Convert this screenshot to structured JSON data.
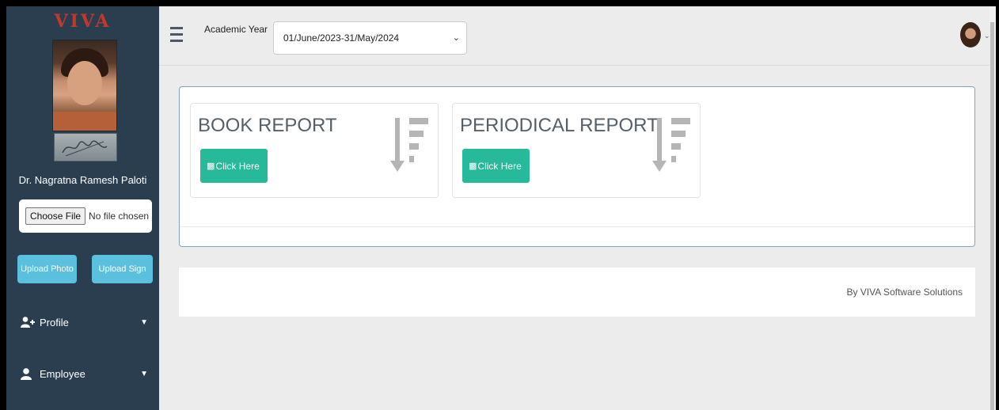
{
  "sidebar": {
    "logo": "VIVA",
    "user_name": "Dr. Nagratna Ramesh Paloti",
    "file_input": {
      "button": "Choose File",
      "status": "No file chosen"
    },
    "upload_photo": "Upload Photo",
    "upload_sign": "Upload Sign",
    "nav": [
      {
        "label": "Profile",
        "icon": "user-plus-icon"
      },
      {
        "label": "Employee",
        "icon": "user-icon"
      }
    ]
  },
  "header": {
    "academic_year_label": "Academic Year",
    "academic_year_value": "01/June/2023-31/May/2024"
  },
  "reports": [
    {
      "title": "BOOK REPORT",
      "button": "Click Here",
      "icon": "sort-amount-desc-icon"
    },
    {
      "title": "PERIODICAL REPORT",
      "button": "Click Here",
      "icon": "sort-amount-desc-icon"
    }
  ],
  "footer": {
    "text": "By VIVA Software Solutions"
  },
  "colors": {
    "sidebar": "#2b3e50",
    "accent": "#26b99a",
    "upload": "#5bc0de",
    "logo": "#c0392b"
  }
}
